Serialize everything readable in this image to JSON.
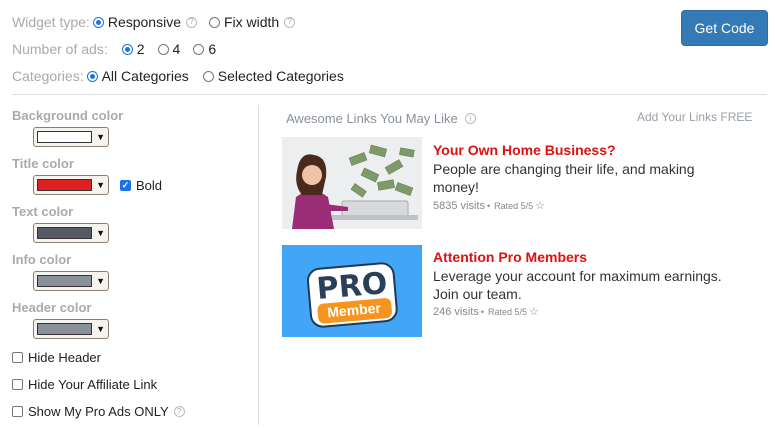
{
  "widget_type": {
    "label": "Widget type:",
    "options": [
      "Responsive",
      "Fix width"
    ],
    "selected": "Responsive"
  },
  "num_ads": {
    "label": "Number of ads:",
    "options": [
      "2",
      "4",
      "6"
    ],
    "selected": "2"
  },
  "categories": {
    "label": "Categories:",
    "options": [
      "All Categories",
      "Selected Categories"
    ],
    "selected": "All Categories"
  },
  "get_code_label": "Get Code",
  "colors": {
    "background": {
      "label": "Background color",
      "value": "#ffffff"
    },
    "title": {
      "label": "Title color",
      "value": "#e02020"
    },
    "text": {
      "label": "Text color",
      "value": "#555a66"
    },
    "info": {
      "label": "Info color",
      "value": "#8a919b"
    },
    "header": {
      "label": "Header color",
      "value": "#8a919b"
    },
    "bold_label": "Bold"
  },
  "options": {
    "hide_header": "Hide Header",
    "hide_affiliate": "Hide Your Affiliate Link",
    "show_pro": "Show My Pro Ads ONLY"
  },
  "preview": {
    "header": "Awesome Links You May Like",
    "add_links": "Add Your Links FREE",
    "ads": [
      {
        "title": "Your Own Home Business?",
        "desc_1": "People are changing their life, and making",
        "desc_2": "money!",
        "visits": "5835 visits",
        "sep": "•",
        "rated": "Rated 5/5"
      },
      {
        "title": "Attention Pro Members",
        "desc_1": "Leverage your account for maximum earnings.",
        "desc_2": "Join our team.",
        "visits": "246 visits",
        "sep": "•",
        "rated": "Rated 5/5"
      }
    ],
    "pro_badge": {
      "line1": "PRO",
      "line2": "Member"
    }
  },
  "accent": "#1a73e8",
  "button_color": "#337ab7"
}
